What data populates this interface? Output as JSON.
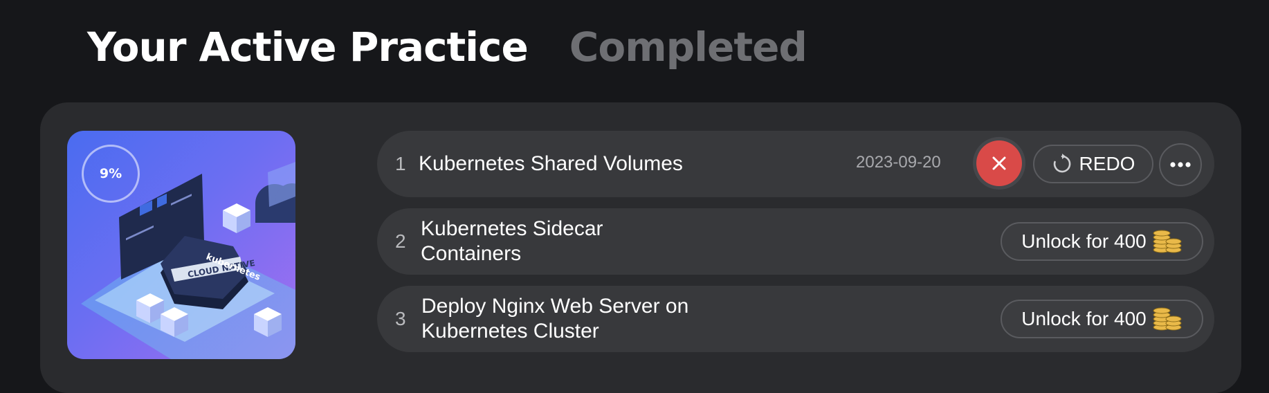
{
  "tabs": [
    {
      "label": "Your Active Practice",
      "active": true
    },
    {
      "label": "Completed",
      "active": false
    }
  ],
  "course": {
    "progress": "9%",
    "progress_value": 0.09,
    "art_icons": [
      "dashboard-panel-graphic",
      "kubernetes-hexagon-graphic",
      "cloud-graphic",
      "server-cube-graphic"
    ],
    "art_text": [
      "kubernetes",
      "CLOUD NATIVE"
    ]
  },
  "exercises": [
    {
      "number": "1",
      "title": "Kubernetes Shared Volumes",
      "date": "2023-09-20",
      "redo_label": "REDO",
      "status": "active"
    },
    {
      "number": "2",
      "title": "Kubernetes Sidecar Containers",
      "unlock_label": "Unlock for 400",
      "status": "locked"
    },
    {
      "number": "3",
      "title": "Deploy Nginx Web Server on Kubernetes Cluster",
      "unlock_label": "Unlock for 400",
      "status": "locked"
    }
  ],
  "colors": {
    "background": "#16171a",
    "panel": "#2a2b2e",
    "row": "#38393c",
    "close_button": "#d94a48",
    "inactive_tab": "#6e6f73",
    "coin": "#e9b949"
  },
  "icons": {
    "close": "close-icon",
    "redo": "redo-icon",
    "more": "more-icon",
    "coins": "coins-icon"
  }
}
